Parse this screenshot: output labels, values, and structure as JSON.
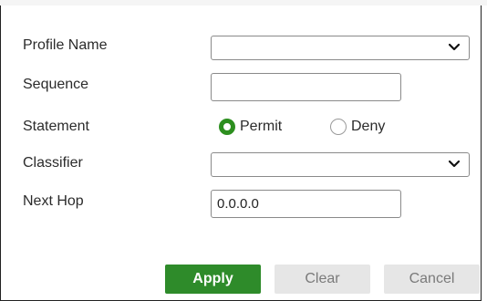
{
  "header": {
    "fragment": ""
  },
  "form": {
    "profile_name": {
      "label": "Profile Name",
      "value": ""
    },
    "sequence": {
      "label": "Sequence",
      "value": ""
    },
    "statement": {
      "label": "Statement",
      "options": [
        {
          "label": "Permit",
          "checked": true
        },
        {
          "label": "Deny",
          "checked": false
        }
      ]
    },
    "classifier": {
      "label": "Classifier",
      "value": ""
    },
    "next_hop": {
      "label": "Next Hop",
      "value": "0.0.0.0"
    }
  },
  "buttons": {
    "apply": "Apply",
    "clear": "Clear",
    "cancel": "Cancel"
  },
  "colors": {
    "accent": "#2e8b2a",
    "radio_checked": "#2d8f1f",
    "button_gray": "#e6e6e6"
  },
  "icons": {
    "select_arrow": "chevron-down-icon"
  }
}
